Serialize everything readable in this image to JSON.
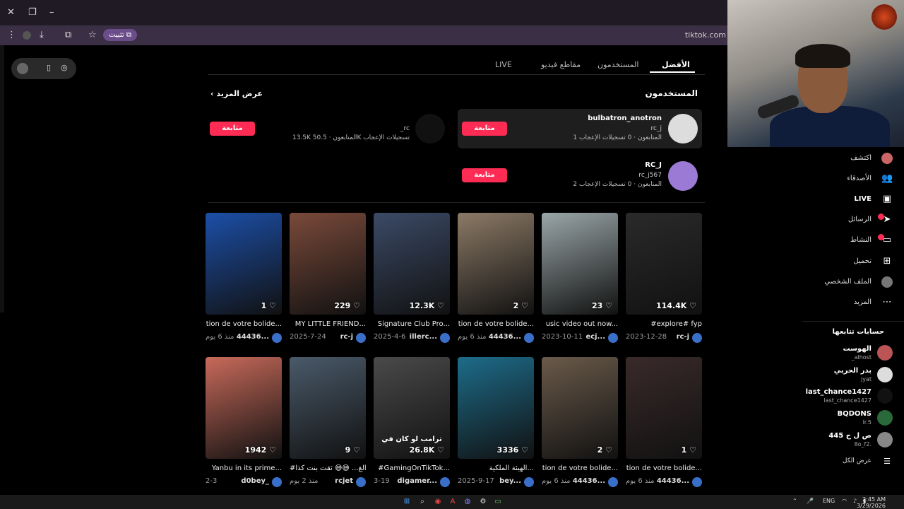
{
  "browser": {
    "install_label": "تثبيت",
    "url": "tiktok.com"
  },
  "tabs": [
    {
      "label": "الأفضل"
    },
    {
      "label": "المستخدمون"
    },
    {
      "label": "مقاطع فيديو"
    },
    {
      "label": "LIVE"
    }
  ],
  "users_section": {
    "title": "المستخدمون",
    "see_more": "عرض المزيد",
    "follow_label": "متابعة",
    "cards": [
      {
        "name": "bulbatron_anotron",
        "handle": "rc_j",
        "followers": "1 المتابعون",
        "likes": "0 تسجيلات الإعجاب"
      },
      {
        "name": "",
        "handle": "_rc",
        "followers": "13.5K المتابعون",
        "likes": "50.5K تسجيلات الإعجاب"
      },
      {
        "name": "RC_J",
        "handle": "rc_j567",
        "followers": "2 المتابعون",
        "likes": "0 تسجيلات الإعجاب"
      }
    ]
  },
  "videos": [
    {
      "likes": "114.4K",
      "title": "#explore# fyp",
      "author": "rc-j",
      "date": "2023-12-28",
      "color": "#2a2a2a"
    },
    {
      "likes": "23",
      "title": "usic video out now...",
      "author": "ecj...",
      "date": "2023-10-11",
      "color": "#9aa6a8"
    },
    {
      "likes": "2",
      "title": "tion de votre bolide...",
      "author": "44436...",
      "date": "منذ 6 يوم",
      "color": "#8c7a66"
    },
    {
      "likes": "12.3K",
      "title": "Signature Club Pro...",
      "author": "illerc...",
      "date": "2025-4-6",
      "color": "#3b4a66"
    },
    {
      "likes": "229",
      "title": "MY LITTLE FRIEND...",
      "author": "rc-j",
      "date": "2025-7-24",
      "color": "#7a4a3a"
    },
    {
      "likes": "1",
      "title": "tion de votre bolide...",
      "author": "44436...",
      "date": "منذ 6 يوم",
      "color": "#1c4fa8"
    },
    {
      "likes": "1",
      "title": "tion de votre bolide...",
      "author": "44436...",
      "date": "منذ 6 يوم",
      "color": "#3a2a2a"
    },
    {
      "likes": "2",
      "title": "tion de votre bolide...",
      "author": "44436...",
      "date": "منذ 6 يوم",
      "color": "#6a5a4a"
    },
    {
      "likes": "3336",
      "title": "الهيئة الملكية...",
      "author": "bey...",
      "date": "2025-9-17",
      "color": "#1d6c8a"
    },
    {
      "likes": "26.8K",
      "title": "#GamingOnTikTok...",
      "author": "digamer...",
      "date": "3-19",
      "color": "#4a4a4a",
      "caption": "ترامب لو كان في"
    },
    {
      "likes": "9",
      "title": "#قرالغ... 😅😅 ثقت بنت كذا",
      "author": "rcjet",
      "date": "منذ 2 يوم",
      "color": "#4a5a6a"
    },
    {
      "likes": "1942",
      "title": "Yanbu in its prime...",
      "author": "d0bey_",
      "date": "2-3",
      "color": "#c86a5a"
    }
  ],
  "right_nav": {
    "items": [
      {
        "label": "اكتشف"
      },
      {
        "label": "الأصدقاء"
      },
      {
        "label": "LIVE"
      },
      {
        "label": "الرسائل"
      },
      {
        "label": "النشاط"
      },
      {
        "label": "تحميل"
      },
      {
        "label": "الملف الشخصي"
      },
      {
        "label": "المزيد"
      }
    ],
    "following_title": "حسابات تتابعها",
    "following": [
      {
        "name": "الهوست",
        "handle": "_alhost"
      },
      {
        "name": "بدر الحربي",
        "handle": "jyat"
      },
      {
        "name": "last_chance1427",
        "handle": "last_chance1427"
      },
      {
        "name": "BQDONS",
        "handle": "lr.5"
      },
      {
        "name": "ص ل ح 445",
        "handle": "8o_f2."
      }
    ],
    "show_all": "عرض الكل"
  },
  "taskbar": {
    "lang": "ENG",
    "time": "2:45 AM",
    "date": "3/29/2026"
  }
}
